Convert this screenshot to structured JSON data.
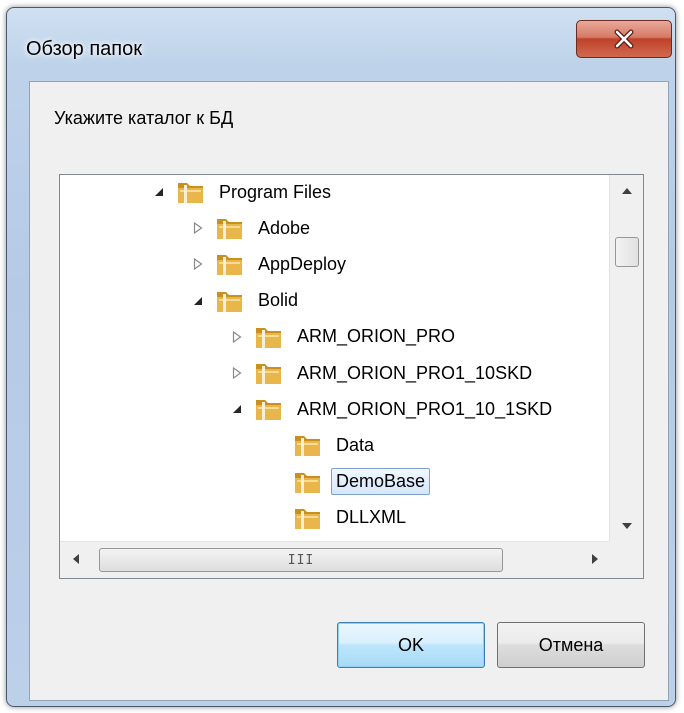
{
  "window": {
    "title": "Обзор папок",
    "close_glyph": "X"
  },
  "dialog": {
    "prompt": "Укажите каталог к БД"
  },
  "tree": {
    "nodes": [
      {
        "label": "Program Files",
        "expander": "expanded",
        "level": 0
      },
      {
        "label": "Adobe",
        "expander": "collapsed",
        "level": 1
      },
      {
        "label": "AppDeploy",
        "expander": "collapsed",
        "level": 1
      },
      {
        "label": "Bolid",
        "expander": "expanded",
        "level": 1
      },
      {
        "label": "ARM_ORION_PRO",
        "expander": "collapsed",
        "level": 2
      },
      {
        "label": "ARM_ORION_PRO1_10SKD",
        "expander": "collapsed",
        "level": 2
      },
      {
        "label": "ARM_ORION_PRO1_10_1SKD",
        "expander": "expanded",
        "level": 2
      },
      {
        "label": "Data",
        "expander": "none",
        "level": 3
      },
      {
        "label": "DemoBase",
        "expander": "none",
        "level": 3,
        "selected": true
      },
      {
        "label": "DLLXML",
        "expander": "none",
        "level": 3
      }
    ],
    "hscroll_grip": "III"
  },
  "buttons": {
    "ok_label": "OK",
    "cancel_label": "Отмена"
  },
  "colors": {
    "frame_accent": "#b5cbe4",
    "close_button": "#c0412a",
    "selection": "#d5e7fc",
    "default_button": "#bee6fd",
    "folder": "#e8b64a"
  }
}
